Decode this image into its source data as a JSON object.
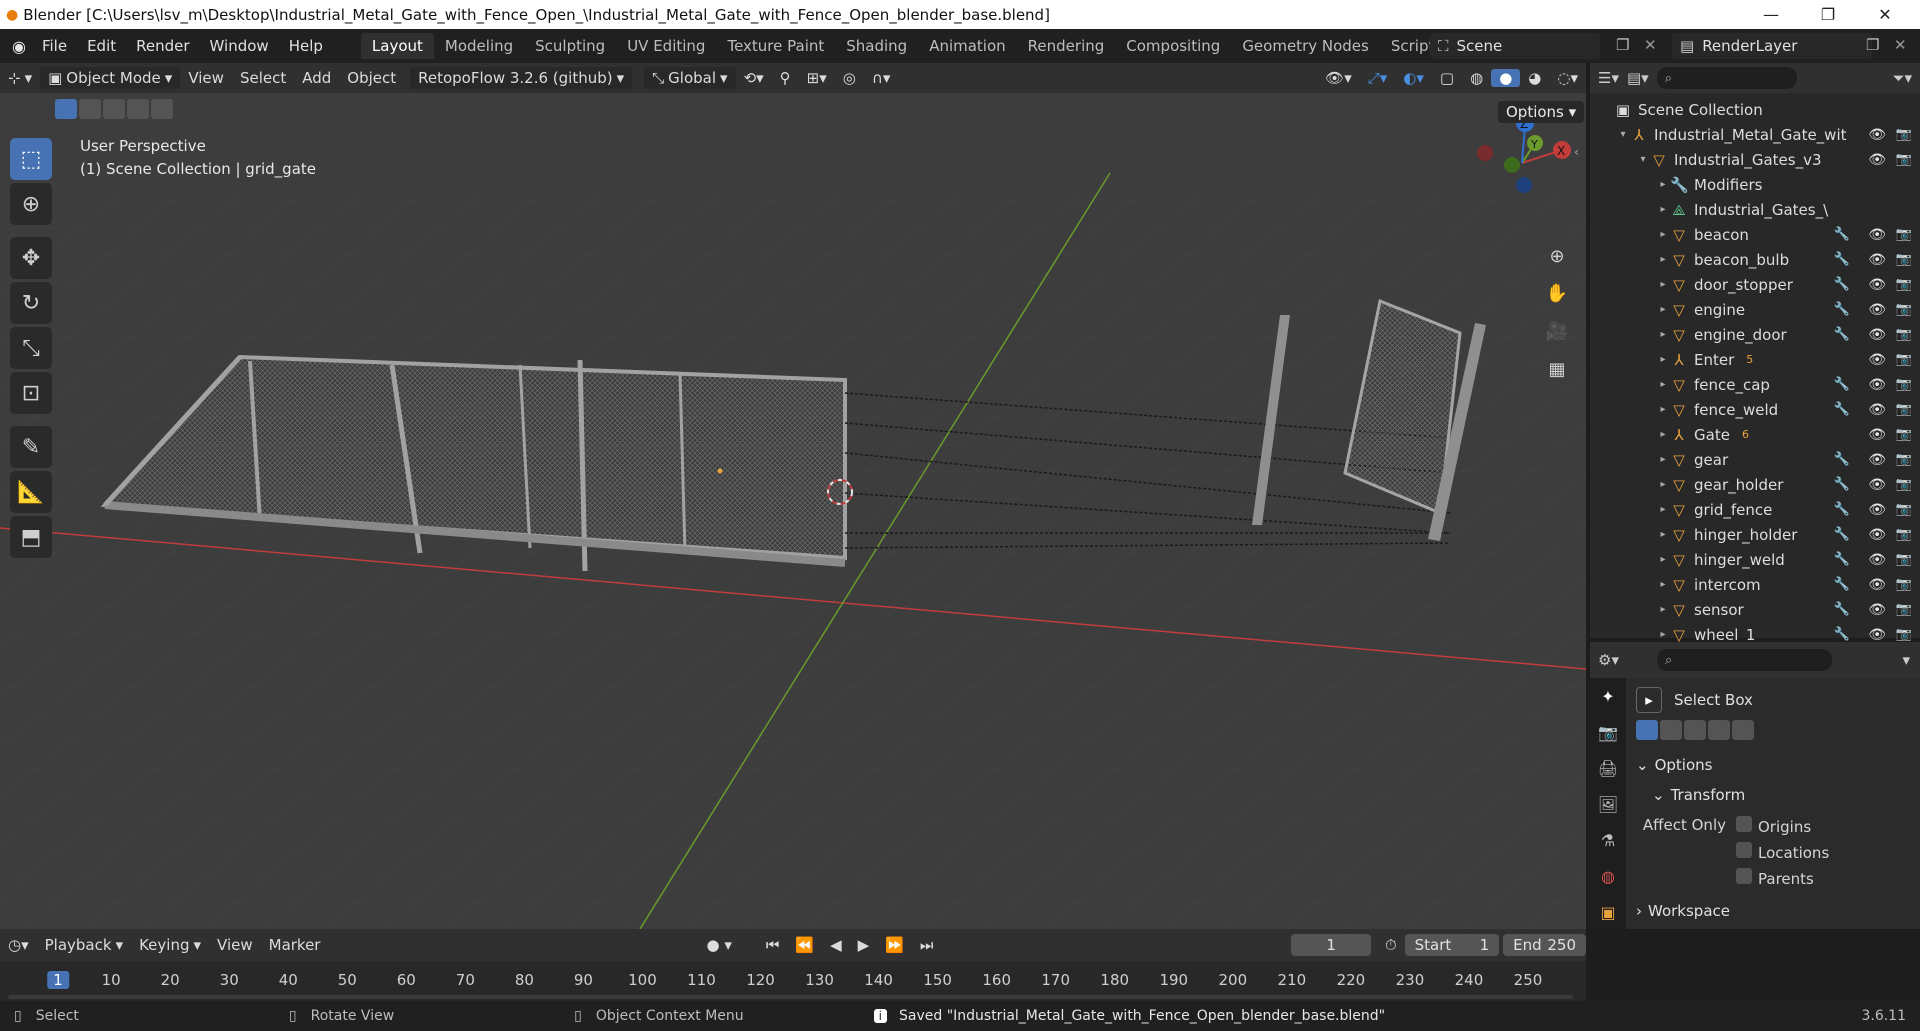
{
  "window": {
    "title": "Blender [C:\\Users\\lsv_m\\Desktop\\Industrial_Metal_Gate_with_Fence_Open_\\Industrial_Metal_Gate_with_Fence_Open_blender_base.blend]",
    "minimize": "—",
    "maximize": "❐",
    "close": "✕"
  },
  "menu": [
    "File",
    "Edit",
    "Render",
    "Window",
    "Help"
  ],
  "workspaces": [
    "Layout",
    "Modeling",
    "Sculpting",
    "UV Editing",
    "Texture Paint",
    "Shading",
    "Animation",
    "Rendering",
    "Compositing",
    "Geometry Nodes",
    "Scripting"
  ],
  "active_workspace": "Layout",
  "scene": {
    "label": "Scene",
    "render_layer": "RenderLayer"
  },
  "viewport_header": {
    "mode": "Object Mode",
    "view": "View",
    "select": "Select",
    "add": "Add",
    "object": "Object",
    "addon": "RetopoFlow 3.2.6 (github)",
    "orientation": "Global",
    "options": "Options"
  },
  "viewport": {
    "perspective": "User Perspective",
    "collection_info": "(1) Scene Collection | grid_gate",
    "axis_x": "X",
    "axis_y": "Y",
    "axis_z": "Z"
  },
  "outliner": {
    "root": "Scene Collection",
    "items": [
      {
        "label": "Industrial_Metal_Gate_wit",
        "icon": "armature-icon",
        "indent": 1
      },
      {
        "label": "Industrial_Gates_v3",
        "icon": "mesh-icon",
        "indent": 2
      },
      {
        "label": "Modifiers",
        "icon": "wrench-icon",
        "indent": 3
      },
      {
        "label": "Industrial_Gates_\\",
        "icon": "mesh-data-icon",
        "indent": 3
      },
      {
        "label": "beacon",
        "icon": "mesh-icon",
        "indent": 3
      },
      {
        "label": "beacon_bulb",
        "icon": "mesh-icon",
        "indent": 3
      },
      {
        "label": "door_stopper",
        "icon": "mesh-icon",
        "indent": 3
      },
      {
        "label": "engine",
        "icon": "mesh-icon",
        "indent": 3
      },
      {
        "label": "engine_door",
        "icon": "mesh-icon",
        "indent": 3
      },
      {
        "label": "Enter",
        "icon": "armature-icon",
        "indent": 3,
        "badge": "5"
      },
      {
        "label": "fence_cap",
        "icon": "mesh-icon",
        "indent": 3
      },
      {
        "label": "fence_weld",
        "icon": "mesh-icon",
        "indent": 3
      },
      {
        "label": "Gate",
        "icon": "armature-icon",
        "indent": 3,
        "badge": "6"
      },
      {
        "label": "gear",
        "icon": "mesh-icon",
        "indent": 3
      },
      {
        "label": "gear_holder",
        "icon": "mesh-icon",
        "indent": 3
      },
      {
        "label": "grid_fence",
        "icon": "mesh-icon",
        "indent": 3
      },
      {
        "label": "hinger_holder",
        "icon": "mesh-icon",
        "indent": 3
      },
      {
        "label": "hinger_weld",
        "icon": "mesh-icon",
        "indent": 3
      },
      {
        "label": "intercom",
        "icon": "mesh-icon",
        "indent": 3
      },
      {
        "label": "sensor",
        "icon": "mesh-icon",
        "indent": 3
      },
      {
        "label": "wheel_1",
        "icon": "mesh-icon",
        "indent": 3
      }
    ]
  },
  "properties": {
    "tool": "Select Box",
    "options": "Options",
    "transform": "Transform",
    "affect_only": "Affect Only",
    "origins": "Origins",
    "locations": "Locations",
    "parents": "Parents",
    "workspace": "Workspace"
  },
  "timeline": {
    "playback": "Playback",
    "keying": "Keying",
    "view": "View",
    "marker": "Marker",
    "current_frame": "1",
    "start_label": "Start",
    "start": "1",
    "end_label": "End",
    "end": "250",
    "ticks": [
      "1",
      "10",
      "20",
      "30",
      "40",
      "50",
      "60",
      "70",
      "80",
      "90",
      "100",
      "110",
      "120",
      "130",
      "140",
      "150",
      "160",
      "170",
      "180",
      "190",
      "200",
      "210",
      "220",
      "230",
      "240",
      "250"
    ]
  },
  "status": {
    "select": "Select",
    "rotate": "Rotate View",
    "context": "Object Context Menu",
    "message": "Saved \"Industrial_Metal_Gate_with_Fence_Open_blender_base.blend\"",
    "version": "3.6.11"
  },
  "colors": {
    "accent": "#4772b3",
    "object": "#e8a23c",
    "x_axis": "#c33c3c",
    "y_axis": "#6a9b2c"
  }
}
